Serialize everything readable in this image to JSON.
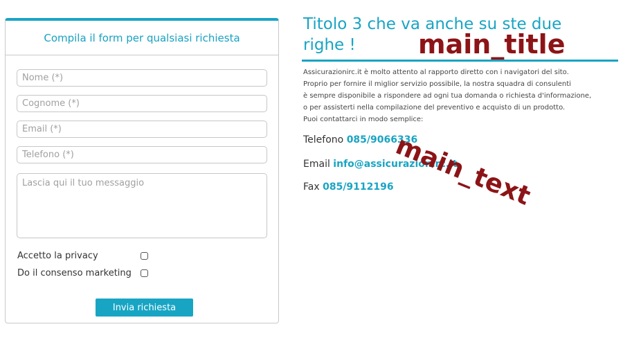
{
  "form": {
    "heading": "Compila il form per qualsiasi richiesta",
    "fields": {
      "name_placeholder": "Nome (*)",
      "surname_placeholder": "Cognome (*)",
      "email_placeholder": "Email (*)",
      "phone_placeholder": "Telefono (*)",
      "message_placeholder": "Lascia qui il tuo messaggio"
    },
    "privacy_label": "Accetto la privacy",
    "marketing_label": "Do il consenso marketing",
    "submit_label": "Invia richiesta"
  },
  "content": {
    "title": "Titolo 3 che va anche su ste due righe !",
    "title_tag": "main_title",
    "text_tag": "main_text",
    "intro_lines": [
      "Assicurazionirc.it è molto attento al rapporto diretto con i navigatori del sito.",
      "Proprio per fornire il miglior servizio possibile, la nostra squadra di consulenti",
      "è sempre disponibile a rispondere ad ogni tua domanda o richiesta d'informazione,",
      "o per assisterti nella compilazione del preventivo e acquisto di un prodotto.",
      "Puoi contattarci in modo semplice:"
    ],
    "phone": {
      "label": "Telefono",
      "value": "085/9066336"
    },
    "email": {
      "label": "Email",
      "value": "info@assicurazionirc.it"
    },
    "fax": {
      "label": "Fax",
      "value": "085/9112196"
    }
  },
  "colors": {
    "accent": "#18a5c4",
    "tag": "#8c1417"
  }
}
